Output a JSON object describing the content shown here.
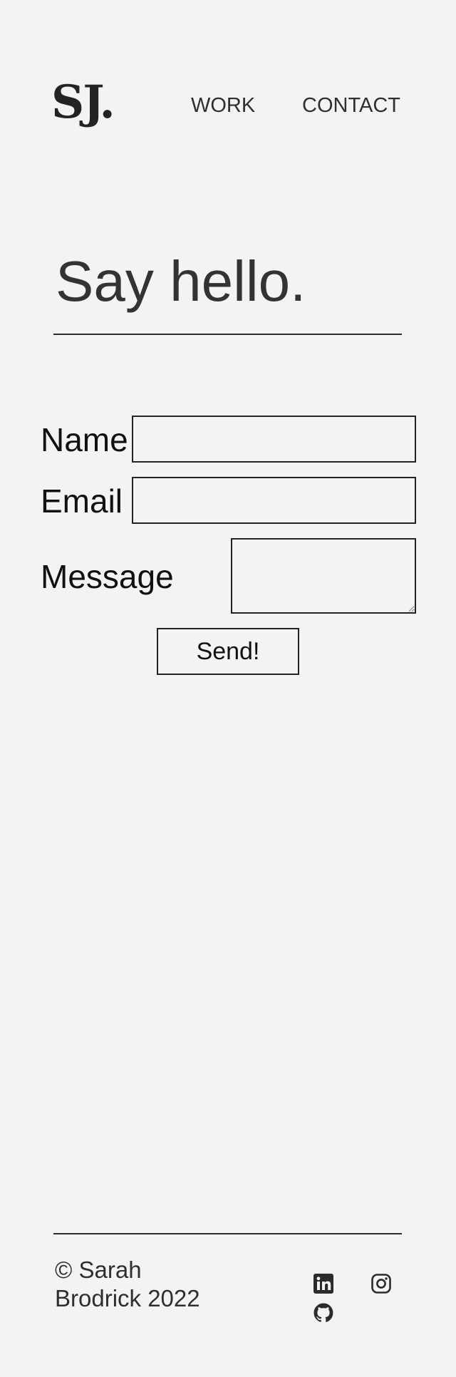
{
  "header": {
    "logo": "SJ.",
    "nav": {
      "work": "WORK",
      "contact": "CONTACT"
    }
  },
  "main": {
    "heading": "Say hello.",
    "form": {
      "name_label": "Name",
      "email_label": "Email",
      "message_label": "Message",
      "name_value": "",
      "email_value": "",
      "message_value": "",
      "submit_label": "Send!"
    }
  },
  "footer": {
    "copyright": "© Sarah Brodrick 2022",
    "social_icons": [
      "linkedin-icon",
      "instagram-icon",
      "github-icon"
    ]
  },
  "colors": {
    "background": "#f3f3f3",
    "text": "#2b2b2b",
    "border": "#222222"
  }
}
